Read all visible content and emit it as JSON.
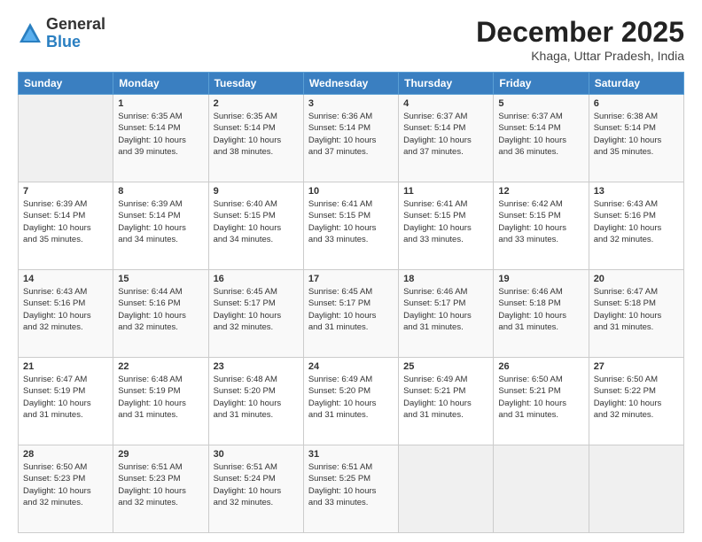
{
  "logo": {
    "general": "General",
    "blue": "Blue"
  },
  "title": "December 2025",
  "location": "Khaga, Uttar Pradesh, India",
  "headers": [
    "Sunday",
    "Monday",
    "Tuesday",
    "Wednesday",
    "Thursday",
    "Friday",
    "Saturday"
  ],
  "weeks": [
    [
      {
        "day": "",
        "info": ""
      },
      {
        "day": "1",
        "info": "Sunrise: 6:35 AM\nSunset: 5:14 PM\nDaylight: 10 hours\nand 39 minutes."
      },
      {
        "day": "2",
        "info": "Sunrise: 6:35 AM\nSunset: 5:14 PM\nDaylight: 10 hours\nand 38 minutes."
      },
      {
        "day": "3",
        "info": "Sunrise: 6:36 AM\nSunset: 5:14 PM\nDaylight: 10 hours\nand 37 minutes."
      },
      {
        "day": "4",
        "info": "Sunrise: 6:37 AM\nSunset: 5:14 PM\nDaylight: 10 hours\nand 37 minutes."
      },
      {
        "day": "5",
        "info": "Sunrise: 6:37 AM\nSunset: 5:14 PM\nDaylight: 10 hours\nand 36 minutes."
      },
      {
        "day": "6",
        "info": "Sunrise: 6:38 AM\nSunset: 5:14 PM\nDaylight: 10 hours\nand 35 minutes."
      }
    ],
    [
      {
        "day": "7",
        "info": "Sunrise: 6:39 AM\nSunset: 5:14 PM\nDaylight: 10 hours\nand 35 minutes."
      },
      {
        "day": "8",
        "info": "Sunrise: 6:39 AM\nSunset: 5:14 PM\nDaylight: 10 hours\nand 34 minutes."
      },
      {
        "day": "9",
        "info": "Sunrise: 6:40 AM\nSunset: 5:15 PM\nDaylight: 10 hours\nand 34 minutes."
      },
      {
        "day": "10",
        "info": "Sunrise: 6:41 AM\nSunset: 5:15 PM\nDaylight: 10 hours\nand 33 minutes."
      },
      {
        "day": "11",
        "info": "Sunrise: 6:41 AM\nSunset: 5:15 PM\nDaylight: 10 hours\nand 33 minutes."
      },
      {
        "day": "12",
        "info": "Sunrise: 6:42 AM\nSunset: 5:15 PM\nDaylight: 10 hours\nand 33 minutes."
      },
      {
        "day": "13",
        "info": "Sunrise: 6:43 AM\nSunset: 5:16 PM\nDaylight: 10 hours\nand 32 minutes."
      }
    ],
    [
      {
        "day": "14",
        "info": "Sunrise: 6:43 AM\nSunset: 5:16 PM\nDaylight: 10 hours\nand 32 minutes."
      },
      {
        "day": "15",
        "info": "Sunrise: 6:44 AM\nSunset: 5:16 PM\nDaylight: 10 hours\nand 32 minutes."
      },
      {
        "day": "16",
        "info": "Sunrise: 6:45 AM\nSunset: 5:17 PM\nDaylight: 10 hours\nand 32 minutes."
      },
      {
        "day": "17",
        "info": "Sunrise: 6:45 AM\nSunset: 5:17 PM\nDaylight: 10 hours\nand 31 minutes."
      },
      {
        "day": "18",
        "info": "Sunrise: 6:46 AM\nSunset: 5:17 PM\nDaylight: 10 hours\nand 31 minutes."
      },
      {
        "day": "19",
        "info": "Sunrise: 6:46 AM\nSunset: 5:18 PM\nDaylight: 10 hours\nand 31 minutes."
      },
      {
        "day": "20",
        "info": "Sunrise: 6:47 AM\nSunset: 5:18 PM\nDaylight: 10 hours\nand 31 minutes."
      }
    ],
    [
      {
        "day": "21",
        "info": "Sunrise: 6:47 AM\nSunset: 5:19 PM\nDaylight: 10 hours\nand 31 minutes."
      },
      {
        "day": "22",
        "info": "Sunrise: 6:48 AM\nSunset: 5:19 PM\nDaylight: 10 hours\nand 31 minutes."
      },
      {
        "day": "23",
        "info": "Sunrise: 6:48 AM\nSunset: 5:20 PM\nDaylight: 10 hours\nand 31 minutes."
      },
      {
        "day": "24",
        "info": "Sunrise: 6:49 AM\nSunset: 5:20 PM\nDaylight: 10 hours\nand 31 minutes."
      },
      {
        "day": "25",
        "info": "Sunrise: 6:49 AM\nSunset: 5:21 PM\nDaylight: 10 hours\nand 31 minutes."
      },
      {
        "day": "26",
        "info": "Sunrise: 6:50 AM\nSunset: 5:21 PM\nDaylight: 10 hours\nand 31 minutes."
      },
      {
        "day": "27",
        "info": "Sunrise: 6:50 AM\nSunset: 5:22 PM\nDaylight: 10 hours\nand 32 minutes."
      }
    ],
    [
      {
        "day": "28",
        "info": "Sunrise: 6:50 AM\nSunset: 5:23 PM\nDaylight: 10 hours\nand 32 minutes."
      },
      {
        "day": "29",
        "info": "Sunrise: 6:51 AM\nSunset: 5:23 PM\nDaylight: 10 hours\nand 32 minutes."
      },
      {
        "day": "30",
        "info": "Sunrise: 6:51 AM\nSunset: 5:24 PM\nDaylight: 10 hours\nand 32 minutes."
      },
      {
        "day": "31",
        "info": "Sunrise: 6:51 AM\nSunset: 5:25 PM\nDaylight: 10 hours\nand 33 minutes."
      },
      {
        "day": "",
        "info": ""
      },
      {
        "day": "",
        "info": ""
      },
      {
        "day": "",
        "info": ""
      }
    ]
  ]
}
